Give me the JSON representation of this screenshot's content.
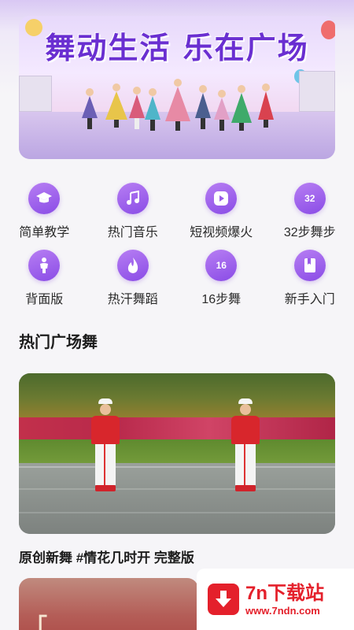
{
  "banner": {
    "title": "舞动生活 乐在广场"
  },
  "categories": [
    {
      "label": "简单教学",
      "icon": "graduation-cap-icon",
      "glyph": ""
    },
    {
      "label": "热门音乐",
      "icon": "music-note-icon",
      "glyph": ""
    },
    {
      "label": "短视频爆火",
      "icon": "play-icon",
      "glyph": ""
    },
    {
      "label": "32步舞步",
      "icon": "number-32-icon",
      "glyph": "32"
    },
    {
      "label": "背面版",
      "icon": "person-icon",
      "glyph": ""
    },
    {
      "label": "热汗舞蹈",
      "icon": "flame-icon",
      "glyph": ""
    },
    {
      "label": "16步舞",
      "icon": "number-16-icon",
      "glyph": "16"
    },
    {
      "label": "新手入门",
      "icon": "bookmark-icon",
      "glyph": ""
    }
  ],
  "section": {
    "title": "热门广场舞"
  },
  "videos": [
    {
      "title": "原创新舞 #情花几时开 完整版"
    },
    {
      "title": "「…"
    }
  ],
  "watermark": {
    "name": "7n下载站",
    "url": "www.7ndn.com"
  },
  "colors": {
    "accent": "#8a4ce6",
    "brand_red": "#e4202b"
  }
}
